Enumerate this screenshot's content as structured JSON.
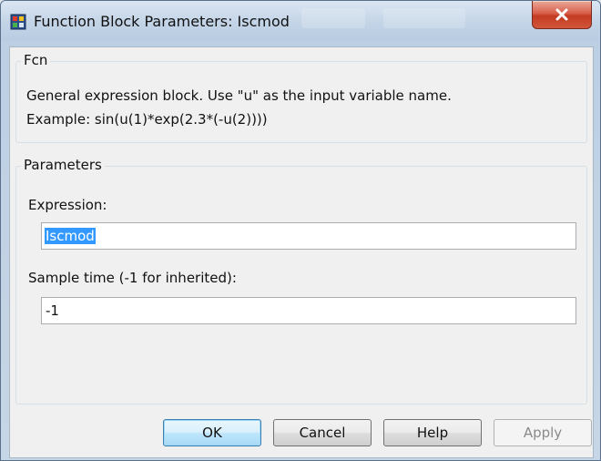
{
  "window": {
    "title": "Function Block Parameters: Iscmod",
    "close_label": "X"
  },
  "description_group": {
    "legend": "Fcn",
    "line1": "General expression block. Use \"u\" as the input variable name.",
    "line2": "Example: sin(u(1)*exp(2.3*(-u(2))))"
  },
  "parameters_group": {
    "legend": "Parameters",
    "expression_label": "Expression:",
    "expression_value": "Iscmod",
    "sample_time_label": "Sample time (-1 for inherited):",
    "sample_time_value": "-1"
  },
  "buttons": {
    "ok": "OK",
    "cancel": "Cancel",
    "help": "Help",
    "apply": "Apply"
  }
}
